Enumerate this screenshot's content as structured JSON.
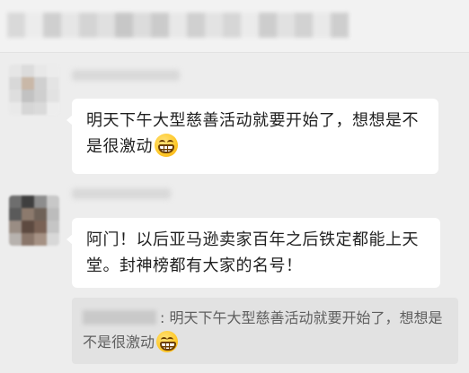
{
  "messages": [
    {
      "text": "明天下午大型慈善活动就要开始了，想想是不是很激动",
      "emoji": "grin-emoji"
    },
    {
      "text": "阿门！以后亚马逊卖家百年之后铁定都能上天堂。封神榜都有大家的名号！"
    }
  ],
  "quote": {
    "text": ": 明天下午大型慈善活动就要开始了，想想是不是很激动",
    "emoji": "grin-emoji"
  },
  "colors": {
    "background": "#ededed",
    "bubble": "#ffffff",
    "quote_bg": "#e2e2e2",
    "text": "#1f1f1f",
    "quote_text": "#5f5f5f"
  }
}
